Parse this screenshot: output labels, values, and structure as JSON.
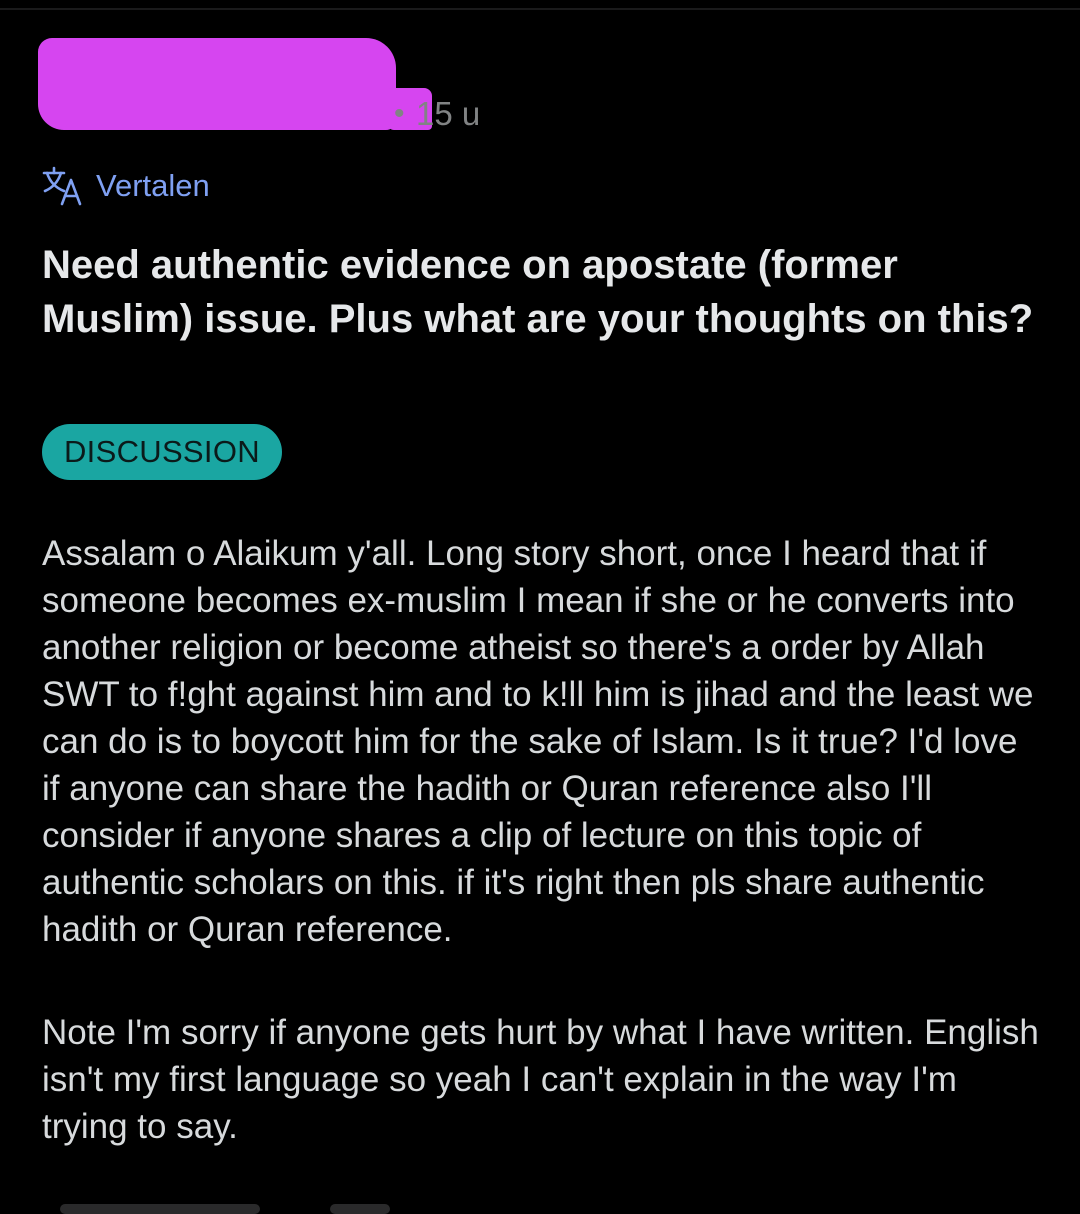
{
  "post": {
    "meta": {
      "author_redacted": true,
      "dot": "•",
      "age": "15 u"
    },
    "translate": {
      "icon": "translate-icon",
      "label": "Vertalen"
    },
    "title": "Need authentic evidence on apostate (former Muslim) issue. Plus what are your thoughts on this?",
    "flair": "DISCUSSION",
    "body": [
      "Assalam o Alaikum y'all. Long story short, once I heard that if someone becomes ex-muslim I mean if she or he converts into another religion or become atheist so there's a order by Allah SWT to f!ght against him and to k!ll him is jihad and the least we can do is to boycott him for the sake of Islam. Is it true? I'd love if anyone can share the hadith or Quran reference also I'll consider if anyone shares a clip of lecture on this topic of authentic scholars on this. if it's right then pls share authentic hadith or Quran reference.",
      "Note I'm sorry if anyone gets hurt by what I have written. English isn't my first language so yeah I can't explain in the way I'm trying to say."
    ]
  },
  "colors": {
    "background": "#000000",
    "redaction": "#d645f0",
    "flair_bg": "#1aa6a2",
    "link": "#7fa0f2",
    "text": "#d7dadc"
  }
}
